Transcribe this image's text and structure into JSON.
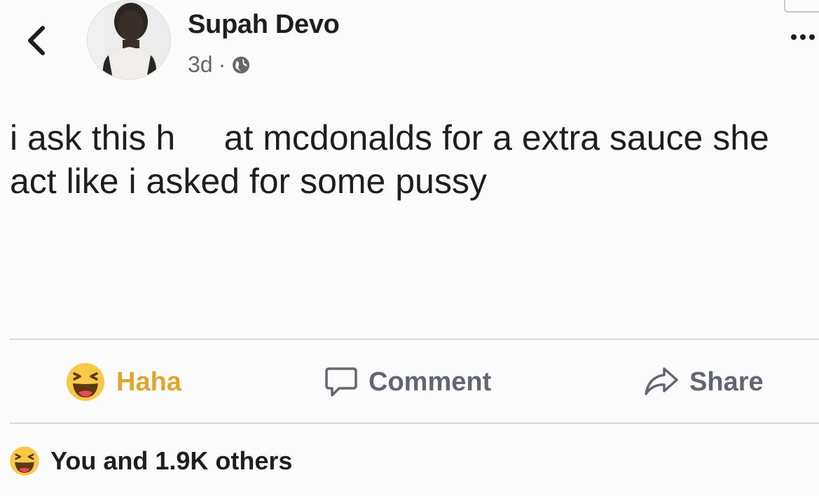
{
  "post": {
    "author_name": "Supah Devo",
    "timestamp": "3d",
    "separator": "·",
    "privacy_icon": "globe-icon",
    "text": "i ask this h     at mcdonalds for a extra sauce she act like i asked for some pussy"
  },
  "header": {
    "back_icon": "chevron-left-icon",
    "more_icon": "more-dots-icon"
  },
  "actions": {
    "haha_label": "Haha",
    "comment_label": "Comment",
    "share_label": "Share"
  },
  "reactions": {
    "summary": "You and 1.9K others",
    "reaction_icon": "haha-emoji-icon"
  },
  "colors": {
    "text": "#1c1e21",
    "secondary_text": "#606770",
    "haha_accent": "#e1a52e",
    "emoji_yellow": "#f7c948",
    "divider": "#d9dadc"
  }
}
